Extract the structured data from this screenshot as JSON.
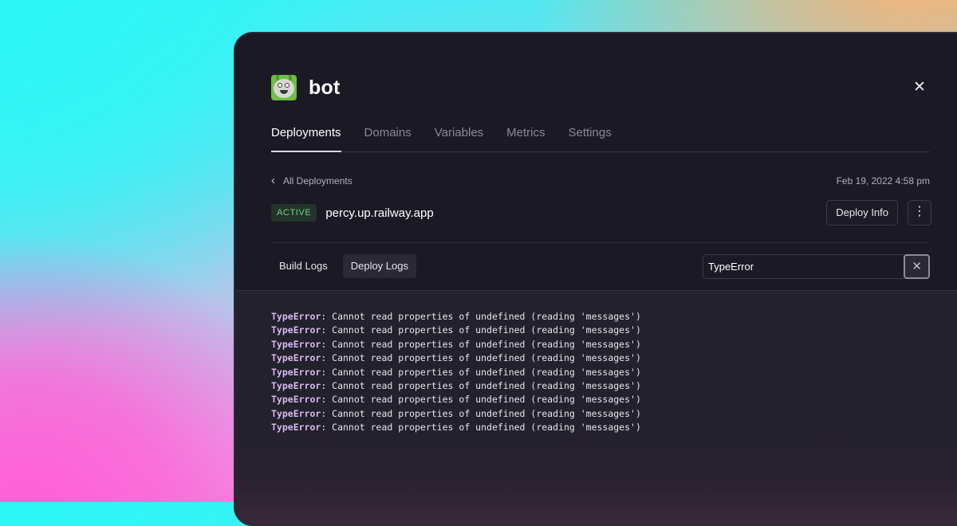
{
  "service": {
    "name": "bot",
    "avatar_icon": "thomas-tank-engine-avatar"
  },
  "tabs": [
    {
      "label": "Deployments",
      "active": true
    },
    {
      "label": "Domains",
      "active": false
    },
    {
      "label": "Variables",
      "active": false
    },
    {
      "label": "Metrics",
      "active": false
    },
    {
      "label": "Settings",
      "active": false
    }
  ],
  "deployment": {
    "back_label": "All Deployments",
    "date": "Feb 19, 2022 4:58 pm",
    "status": "ACTIVE",
    "url": "percy.up.railway.app",
    "deploy_info_label": "Deploy Info"
  },
  "logs": {
    "tabs": [
      {
        "label": "Build Logs",
        "active": false
      },
      {
        "label": "Deploy Logs",
        "active": true
      }
    ],
    "search_value": "TypeError",
    "lines": [
      {
        "match": "TypeError",
        "rest": ": Cannot read properties of undefined (reading 'messages')"
      },
      {
        "match": "TypeError",
        "rest": ": Cannot read properties of undefined (reading 'messages')"
      },
      {
        "match": "TypeError",
        "rest": ": Cannot read properties of undefined (reading 'messages')"
      },
      {
        "match": "TypeError",
        "rest": ": Cannot read properties of undefined (reading 'messages')"
      },
      {
        "match": "TypeError",
        "rest": ": Cannot read properties of undefined (reading 'messages')"
      },
      {
        "match": "TypeError",
        "rest": ": Cannot read properties of undefined (reading 'messages')"
      },
      {
        "match": "TypeError",
        "rest": ": Cannot read properties of undefined (reading 'messages')"
      },
      {
        "match": "TypeError",
        "rest": ": Cannot read properties of undefined (reading 'messages')"
      },
      {
        "match": "TypeError",
        "rest": ": Cannot read properties of undefined (reading 'messages')"
      }
    ]
  },
  "colors": {
    "window_bg": "#1b1a24",
    "active_badge_text": "#6ed584",
    "active_badge_bg": "#23342a",
    "log_highlight": "#d8b8f0"
  }
}
